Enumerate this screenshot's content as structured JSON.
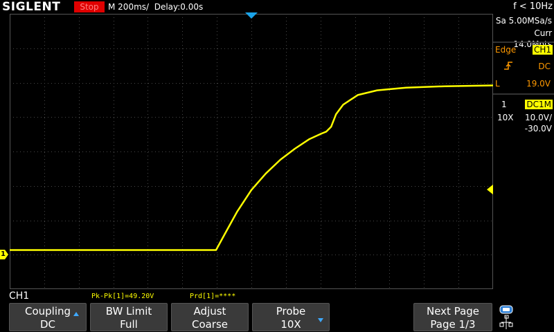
{
  "header": {
    "brand": "SIGLENT",
    "run_state": "Stop",
    "timebase": "M 200ms/",
    "delay": "Delay:0.00s",
    "trigger_freq": "f < 10Hz"
  },
  "acquisition": {
    "sample_rate": "Sa 5.00MSa/s",
    "memory": "Curr 14.0Mpts"
  },
  "trigger": {
    "type": "Edge",
    "source": "CH1",
    "coupling": "DC",
    "level_label": "L",
    "level": "19.0V"
  },
  "channel": {
    "number": "1",
    "input": "DC1M",
    "probe": "10X",
    "scale": "10.0V/",
    "offset": "-30.0V",
    "marker": "1"
  },
  "status": {
    "active_channel": "CH1",
    "measure_pkpk": "Pk-Pk[1]=49.20V",
    "measure_prd": "Prd[1]=****"
  },
  "softkeys": [
    {
      "line1": "Coupling",
      "line2": "DC"
    },
    {
      "line1": "BW Limit",
      "line2": "Full"
    },
    {
      "line1": "Adjust",
      "line2": "Coarse"
    },
    {
      "line1": "Probe",
      "line2": "10X"
    },
    {
      "line1": "Next Page",
      "line2": "Page 1/3"
    }
  ],
  "colors": {
    "trace": "#ffff00",
    "trigger_marker": "#1aa3e8",
    "accent_orange": "#ff9900",
    "stop_red": "#e00000"
  },
  "icons": [
    "trigger-position-marker-icon",
    "rising-edge-icon",
    "trigger-level-marker-icon",
    "channel-marker-icon",
    "network-icon",
    "usb-icon"
  ]
}
